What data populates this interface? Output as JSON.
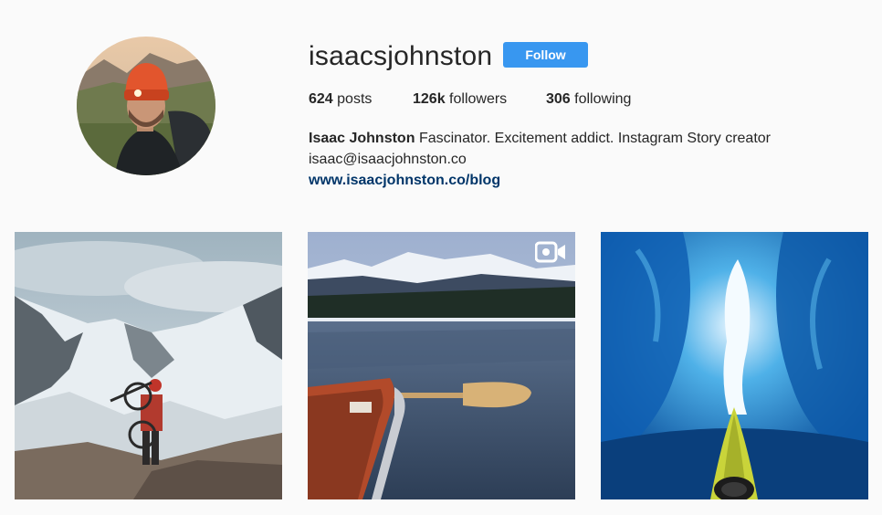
{
  "profile": {
    "username": "isaacsjohnston",
    "follow_label": "Follow",
    "stats": {
      "posts_count": "624",
      "posts_label": "posts",
      "followers_count": "126k",
      "followers_label": "followers",
      "following_count": "306",
      "following_label": "following"
    },
    "bio": {
      "full_name": "Isaac Johnston",
      "description": "Fascinator. Excitement addict. Instagram Story creator",
      "email": "isaac@isaacjohnston.co",
      "website": "www.isaacjohnston.co/blog"
    }
  },
  "posts": [
    {
      "subject": "mountain-hiker-with-bike",
      "is_video": false
    },
    {
      "subject": "canoe-on-lake",
      "is_video": true
    },
    {
      "subject": "kayak-in-ice-cave",
      "is_video": false
    }
  ],
  "colors": {
    "background": "#fafafa",
    "follow_button": "#3897f0",
    "link": "#003569",
    "text": "#262626"
  },
  "icons": {
    "video": "video-camera-icon"
  }
}
